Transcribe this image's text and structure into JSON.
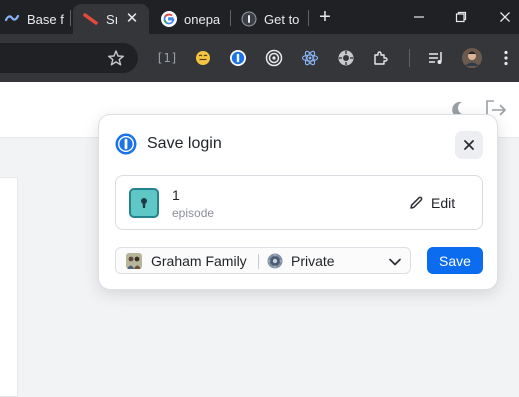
{
  "browser": {
    "tabs": [
      {
        "title": "Base f",
        "icon": "base-icon"
      },
      {
        "title": "Sı",
        "icon": "red-swoosh-icon",
        "active": true
      },
      {
        "title": "onepa",
        "icon": "google-icon"
      },
      {
        "title": "Get to",
        "icon": "onepassword-icon"
      }
    ],
    "toolbar_icons": [
      "star-icon",
      "bracket-1-icon",
      "emoji-icon",
      "onepassword-extension-icon",
      "target-icon",
      "react-icon",
      "gear-extension-icon",
      "puzzle-icon",
      "media-queue-icon",
      "profile-avatar"
    ],
    "bracket_label": "[1]"
  },
  "page": {
    "header_icons": [
      "moon-icon",
      "sign-out-icon"
    ]
  },
  "popup": {
    "title": "Save login",
    "item": {
      "title": "1",
      "subtitle": "episode",
      "edit_label": "Edit"
    },
    "account": {
      "name": "Graham Family"
    },
    "vault": {
      "name": "Private"
    },
    "save_label": "Save",
    "colors": {
      "accent": "#0b6cf0",
      "item_icon": "#5fc7c5"
    }
  }
}
